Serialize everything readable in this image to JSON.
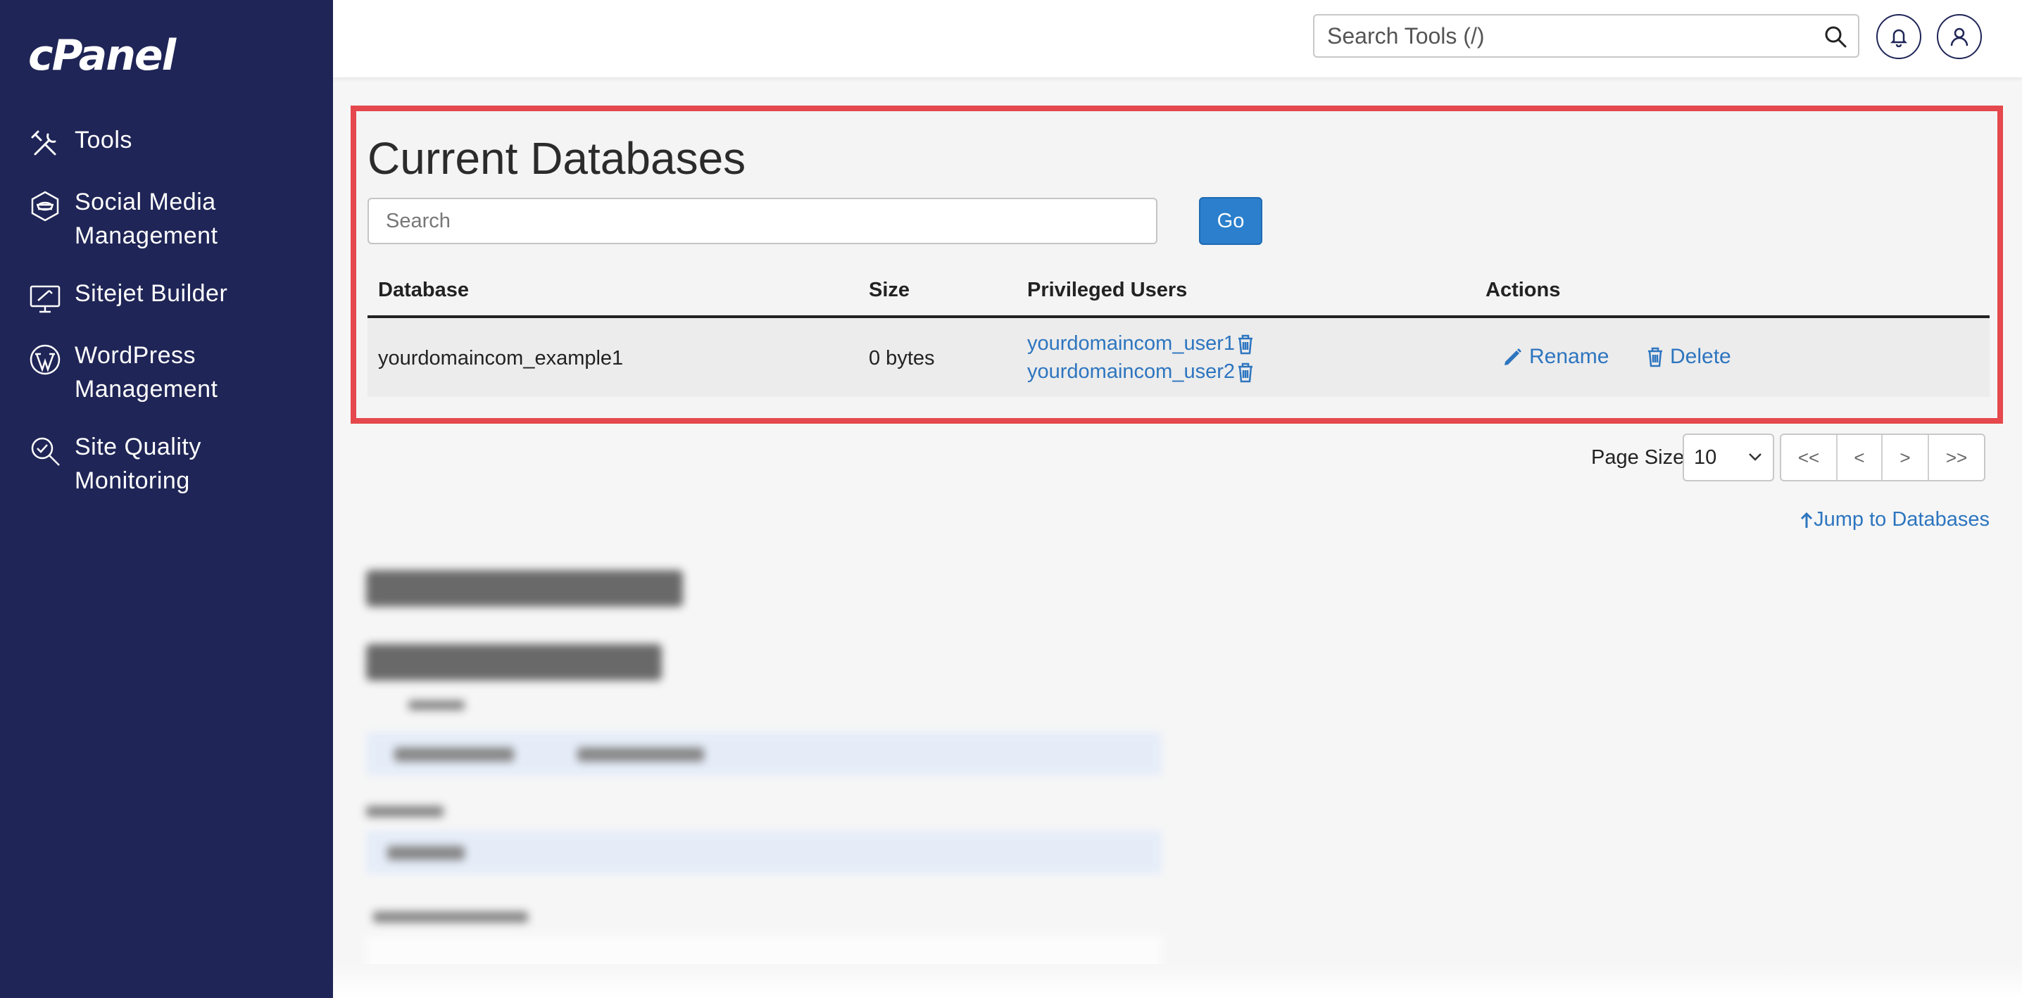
{
  "app": {
    "logo": "cPanel"
  },
  "sidebar": {
    "items": [
      {
        "label_line1": "Tools",
        "label_line2": "",
        "icon": "tools-icon"
      },
      {
        "label_line1": "Social Media",
        "label_line2": "Management",
        "icon": "social-media-icon"
      },
      {
        "label_line1": "Sitejet Builder",
        "label_line2": "",
        "icon": "sitejet-icon"
      },
      {
        "label_line1": "WordPress",
        "label_line2": "Management",
        "icon": "wordpress-icon"
      },
      {
        "label_line1": "Site Quality",
        "label_line2": "Monitoring",
        "icon": "site-quality-icon"
      }
    ]
  },
  "header": {
    "search_placeholder": "Search Tools (/)",
    "icons": [
      "search-icon",
      "bell-icon",
      "user-icon"
    ]
  },
  "main": {
    "title": "Current Databases",
    "search_placeholder": "Search",
    "go_label": "Go",
    "columns": [
      "Database",
      "Size",
      "Privileged Users",
      "Actions"
    ],
    "rows": [
      {
        "database": "yourdomaincom_example1",
        "size": "0 bytes",
        "users": [
          "yourdomaincom_user1",
          "yourdomaincom_user2"
        ],
        "rename_label": "Rename",
        "delete_label": "Delete"
      }
    ],
    "page_size_label": "Page Size",
    "page_size_value": "10",
    "pager": [
      "<<",
      "<",
      ">",
      ">>"
    ],
    "jump_label": "Jump to Databases"
  },
  "colors": {
    "sidebar_bg": "#1f2556",
    "accent": "#2b7fcc",
    "link": "#2d75bf",
    "highlight_border": "#e5484d"
  }
}
